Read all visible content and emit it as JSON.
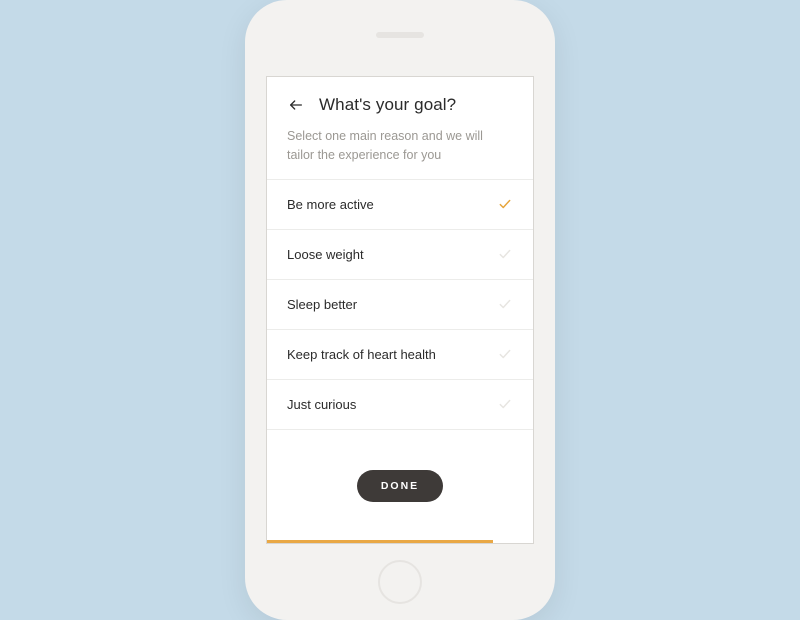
{
  "header": {
    "title": "What's your goal?",
    "subtitle": "Select one main reason and we will tailor the experience for you"
  },
  "options": [
    {
      "label": "Be more active",
      "selected": true
    },
    {
      "label": "Loose weight",
      "selected": false
    },
    {
      "label": "Sleep better",
      "selected": false
    },
    {
      "label": "Keep track of heart health",
      "selected": false
    },
    {
      "label": "Just curious",
      "selected": false
    }
  ],
  "footer": {
    "done_label": "DONE"
  },
  "progress": {
    "percent": 85
  },
  "colors": {
    "accent": "#e6a43a",
    "background": "#c4dae8",
    "button_bg": "#3e3a38"
  }
}
